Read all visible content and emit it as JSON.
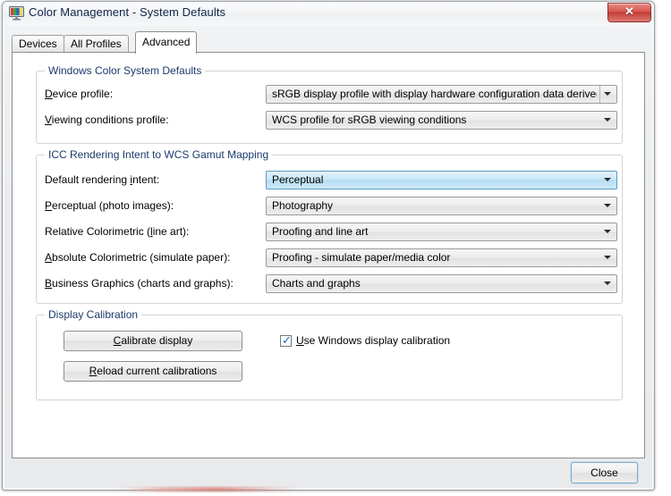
{
  "window": {
    "title": "Color Management - System Defaults",
    "icon": "color-monitor-icon",
    "close_glyph": "✕"
  },
  "tabs": [
    {
      "label": "Devices",
      "active": false
    },
    {
      "label": "All Profiles",
      "active": false
    },
    {
      "label": "Advanced",
      "active": true
    }
  ],
  "groups": {
    "wcs_defaults": {
      "title": "Windows Color System Defaults",
      "fields": [
        {
          "label_pre": "",
          "label_key": "D",
          "label_post": "evice profile:",
          "value": "sRGB display profile with display hardware configuration data derived f"
        },
        {
          "label_pre": "",
          "label_key": "V",
          "label_post": "iewing conditions profile:",
          "value": "WCS profile for sRGB viewing conditions"
        }
      ]
    },
    "icc_mapping": {
      "title": "ICC Rendering Intent to WCS Gamut Mapping",
      "fields": [
        {
          "label_pre": "Default rendering ",
          "label_key": "i",
          "label_post": "ntent:",
          "value": "Perceptual"
        },
        {
          "label_pre": "",
          "label_key": "P",
          "label_post": "erceptual (photo images):",
          "value": "Photography"
        },
        {
          "label_pre": "Relative Colorimetric (",
          "label_key": "l",
          "label_post": "ine art):",
          "value": "Proofing and line art"
        },
        {
          "label_pre": "",
          "label_key": "A",
          "label_post": "bsolute Colorimetric (simulate paper):",
          "value": "Proofing - simulate paper/media color"
        },
        {
          "label_pre": "",
          "label_key": "B",
          "label_post": "usiness Graphics (charts and graphs):",
          "value": "Charts and graphs"
        }
      ]
    },
    "display_calibration": {
      "title": "Display Calibration",
      "calibrate_pre": "",
      "calibrate_key": "C",
      "calibrate_post": "alibrate display",
      "reload_pre": "",
      "reload_key": "R",
      "reload_post": "eload current calibrations",
      "checkbox": {
        "checked": true,
        "tick": "✓",
        "label_pre": "",
        "label_key": "U",
        "label_post": "se Windows display calibration"
      }
    }
  },
  "footer": {
    "close_label": "Close"
  },
  "colors": {
    "group_title": "#1b3a6b",
    "focus_blue": "#b3ddf3",
    "close_red": "#c23c36",
    "check_blue": "#2a6faa"
  }
}
